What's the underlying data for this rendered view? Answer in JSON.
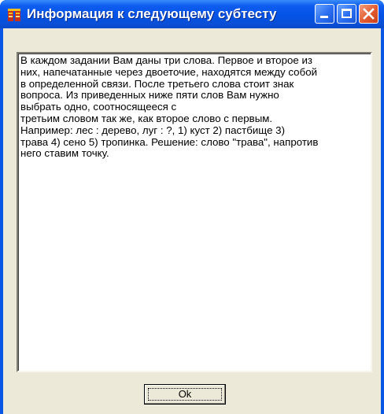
{
  "window": {
    "title": "Информация к следующему субтесту"
  },
  "titlebar_buttons": {
    "minimize": "minimize-icon",
    "maximize": "maximize-icon",
    "close": "close-icon"
  },
  "memo": {
    "text": "В каждом задании Вам даны три слова. Первое и второе из\nних, напечатанные через двоеточие, находятся между собой\nв определенной связи. После третьего слова стоит знак\nвопроса. Из приведенных ниже пяти слов Вам нужно\nвыбрать одно, соотносящееся с\nтретьим словом так же, как второе слово с первым.\nНапример:   лес : дерево,  луг : ?,  1) куст 2) пастбище 3)\nтрава 4) сено 5) тропинка. Решение: слово \"трава\", напротив\nнего ставим точку."
  },
  "buttons": {
    "ok_label": "Ok"
  },
  "colors": {
    "titlebar": "#0453e6",
    "client": "#ece9d8",
    "close": "#e15a2e"
  }
}
